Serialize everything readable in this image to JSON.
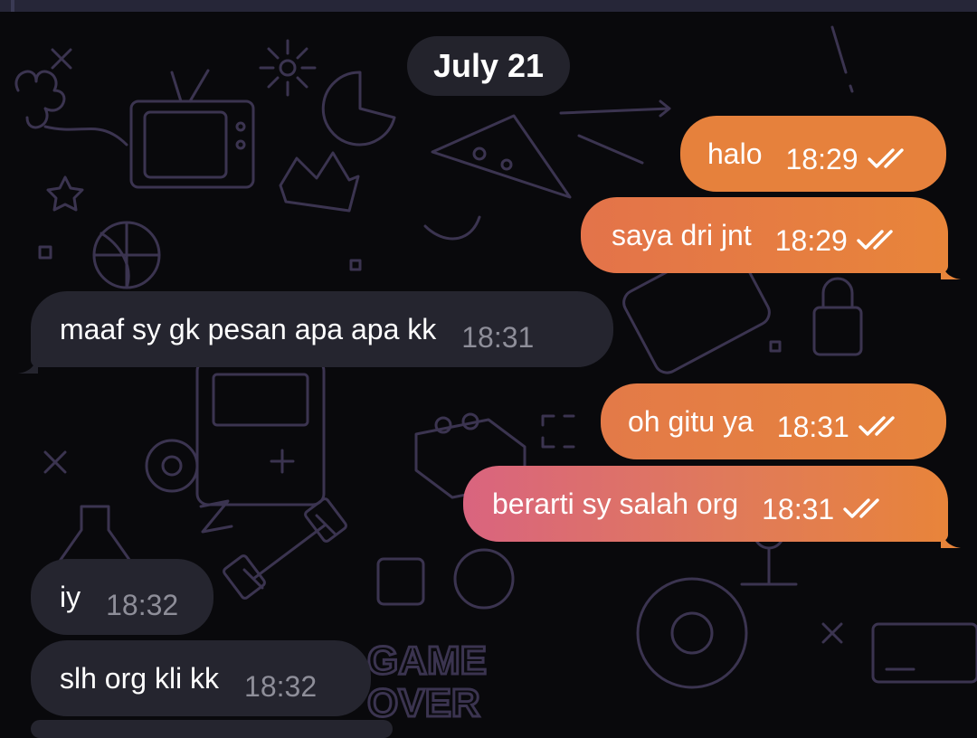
{
  "date_separator": "July 21",
  "wallpaper": {
    "game_over_text": [
      "GAME",
      "OVER"
    ]
  },
  "colors": {
    "incoming_bubble": "#25252f",
    "outgoing_orange": "#e8833a",
    "outgoing_pink": "#d9647f",
    "incoming_time": "#8e8e99"
  },
  "messages": [
    {
      "direction": "out",
      "text": "halo",
      "time": "18:29",
      "status_icon": "double-check-icon"
    },
    {
      "direction": "out",
      "text": "saya dri jnt",
      "time": "18:29",
      "status_icon": "double-check-icon"
    },
    {
      "direction": "in",
      "text": "maaf sy gk pesan apa apa kk",
      "time": "18:31"
    },
    {
      "direction": "out",
      "text": "oh gitu ya",
      "time": "18:31",
      "status_icon": "double-check-icon"
    },
    {
      "direction": "out",
      "text": "berarti sy salah org",
      "time": "18:31",
      "status_icon": "double-check-icon"
    },
    {
      "direction": "in",
      "text": "iy",
      "time": "18:32"
    },
    {
      "direction": "in",
      "text": "slh org kli kk",
      "time": "18:32"
    }
  ]
}
